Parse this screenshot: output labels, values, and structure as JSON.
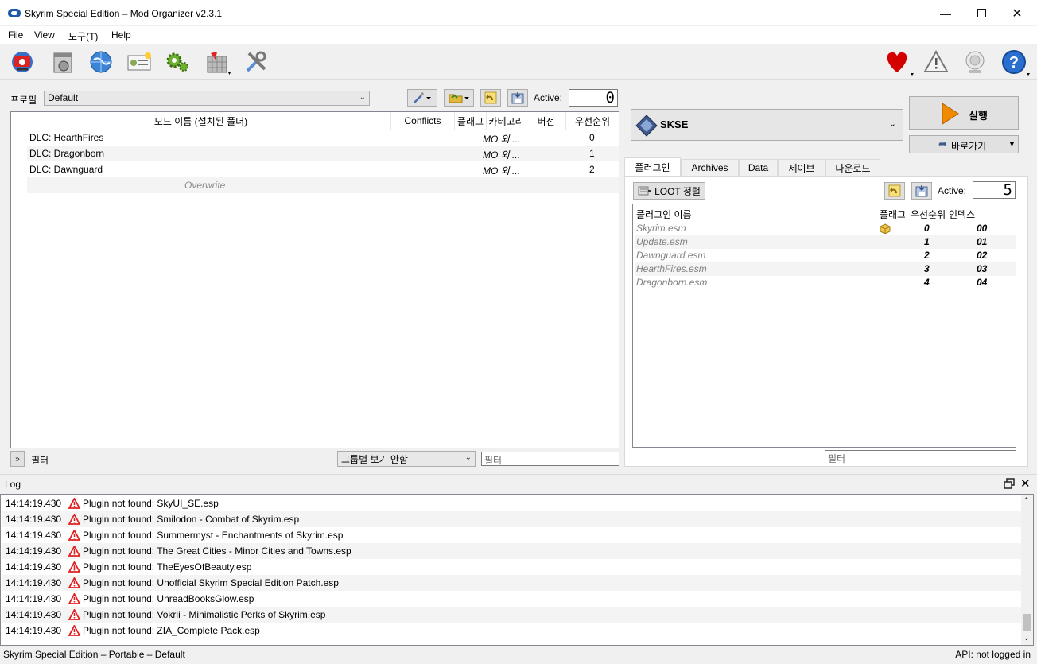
{
  "window": {
    "title": "Skyrim Special Edition – Mod Organizer v2.3.1",
    "controls": [
      "minimize-icon",
      "maximize-icon",
      "close-icon"
    ]
  },
  "menu": [
    {
      "label": "File"
    },
    {
      "label": "View"
    },
    {
      "label": "도구(T)"
    },
    {
      "label": "Help"
    }
  ],
  "toolbar": {
    "left_icons": [
      "change-game-icon",
      "install-mod-icon",
      "nexus-globe-icon",
      "profiles-icon",
      "executables-gear-icon",
      "tools-puzzle-icon",
      "settings-wrench-icon"
    ],
    "right_icons": [
      "endorse-heart-icon",
      "problems-warning-icon",
      "update-icon",
      "help-icon"
    ]
  },
  "profile": {
    "label": "프로필",
    "selected": "Default",
    "active_label": "Active:",
    "active_count": "0"
  },
  "modlist": {
    "columns": [
      "모드 이름 (설치된 폴더)",
      "Conflicts",
      "플래그",
      "카테고리",
      "버전",
      "우선순위"
    ],
    "rows": [
      {
        "name": "DLC: HearthFires",
        "category": "MO 외 ...",
        "priority": "0"
      },
      {
        "name": "DLC: Dragonborn",
        "category": "MO 외 ...",
        "priority": "1"
      },
      {
        "name": "DLC: Dawnguard",
        "category": "MO 외 ...",
        "priority": "2"
      }
    ],
    "overwrite": "Overwrite"
  },
  "left_footer": {
    "expand_label": "»",
    "filter_label": "필터",
    "group_select": "그룹별 보기 안함",
    "filter_placeholder": "필터"
  },
  "executable": {
    "selected": "SKSE",
    "run_label": "실행",
    "shortcut_label": "바로가기"
  },
  "tabs": [
    {
      "label": "플러그인",
      "active": true
    },
    {
      "label": "Archives"
    },
    {
      "label": "Data"
    },
    {
      "label": "세이브"
    },
    {
      "label": "다운로드"
    }
  ],
  "plugins": {
    "loot_button": "LOOT 정렬",
    "active_label": "Active:",
    "active_count": "5",
    "columns": [
      "플러그인 이름",
      "플래그",
      "우선순위",
      "인덱스"
    ],
    "rows": [
      {
        "name": "Skyrim.esm",
        "priority": "0",
        "index": "00",
        "flag": "package-icon"
      },
      {
        "name": "Update.esm",
        "priority": "1",
        "index": "01"
      },
      {
        "name": "Dawnguard.esm",
        "priority": "2",
        "index": "02"
      },
      {
        "name": "HearthFires.esm",
        "priority": "3",
        "index": "03"
      },
      {
        "name": "Dragonborn.esm",
        "priority": "4",
        "index": "04"
      }
    ],
    "filter_placeholder": "필터"
  },
  "log": {
    "title": "Log",
    "entries": [
      {
        "time": "14:14:19.430",
        "message": "Plugin not found: SkyUI_SE.esp"
      },
      {
        "time": "14:14:19.430",
        "message": "Plugin not found: Smilodon - Combat of Skyrim.esp"
      },
      {
        "time": "14:14:19.430",
        "message": "Plugin not found: Summermyst - Enchantments of Skyrim.esp"
      },
      {
        "time": "14:14:19.430",
        "message": "Plugin not found: The Great Cities - Minor Cities and Towns.esp"
      },
      {
        "time": "14:14:19.430",
        "message": "Plugin not found: TheEyesOfBeauty.esp"
      },
      {
        "time": "14:14:19.430",
        "message": "Plugin not found: Unofficial Skyrim Special Edition Patch.esp"
      },
      {
        "time": "14:14:19.430",
        "message": "Plugin not found: UnreadBooksGlow.esp"
      },
      {
        "time": "14:14:19.430",
        "message": "Plugin not found: Vokrii - Minimalistic Perks of Skyrim.esp"
      },
      {
        "time": "14:14:19.430",
        "message": "Plugin not found: ZIA_Complete Pack.esp"
      }
    ]
  },
  "status": {
    "left": "Skyrim Special Edition – Portable – Default",
    "right": "API: not logged in"
  },
  "colors": {
    "accent": "#1e5aa8",
    "warning": "#e81123",
    "run_arrow": "#f08a00",
    "heart": "#d40000"
  }
}
